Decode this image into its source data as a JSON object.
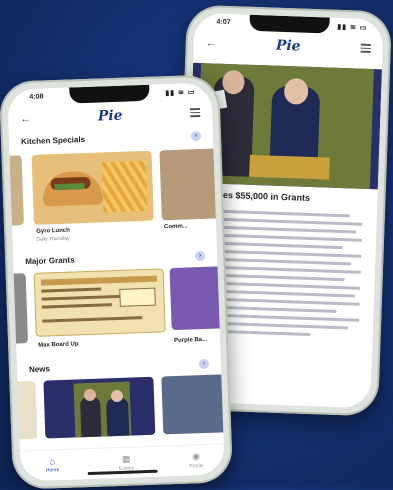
{
  "back_phone": {
    "status_time": "4:07",
    "status_icons": "▮▮ ≋ ▭",
    "logo": "Pie",
    "back_icon": "back-arrow-icon",
    "menu_icon": "hamburger-menu-icon",
    "headline": "...cates $55,000 in Grants"
  },
  "front_phone": {
    "status_time": "4:08",
    "status_icons": "▮▮ ≋ ▭",
    "logo": "Pie",
    "back_icon": "back-arrow-icon",
    "menu_icon": "hamburger-menu-icon",
    "sections": {
      "kitchen": {
        "title": "Kitchen Specials",
        "arrow": "›",
        "items": [
          {
            "caption": "Gyro Lunch",
            "sub": "Daily Thursday"
          },
          {
            "caption": "Comm...",
            "sub": ""
          }
        ]
      },
      "grants": {
        "title": "Major Grants",
        "arrow": "›",
        "items": [
          {
            "caption": "Max Board Up",
            "sub": ""
          },
          {
            "caption": "Purple Ba...",
            "sub": ""
          }
        ]
      },
      "news": {
        "title": "News",
        "arrow": "›"
      }
    },
    "tabs": [
      {
        "label": "Home",
        "icon": "home-icon",
        "glyph": "⌂"
      },
      {
        "label": "Events",
        "icon": "calendar-icon",
        "glyph": "▦"
      },
      {
        "label": "Profile",
        "icon": "profile-icon",
        "glyph": "◉"
      }
    ]
  }
}
